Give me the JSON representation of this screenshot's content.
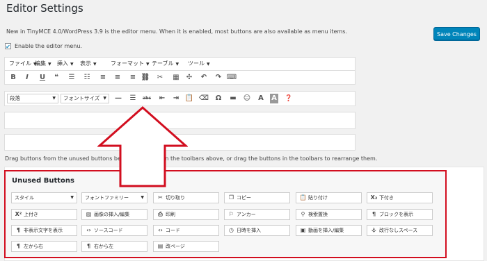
{
  "page": {
    "title": "Editor Settings",
    "description": "New in TinyMCE 4.0/WordPress 3.9 is the editor menu. When it is enabled, most buttons are also available as menu items.",
    "save_label": "Save Changes",
    "enable_label": "Enable the editor menu.",
    "enable_checked": "✔",
    "drag_text": "Drag buttons from the unused buttons be",
    "drag_text_tail": "em in the toolbars above, or drag the buttons in the toolbars to rearrange them."
  },
  "menubar": [
    "ファイル",
    "編集",
    "挿入",
    "表示",
    "フォーマット",
    "テーブル",
    "ツール"
  ],
  "toolbar1": [
    {
      "icon": "bold-icon",
      "glyph": "B"
    },
    {
      "icon": "italic-icon",
      "glyph": "I"
    },
    {
      "icon": "underline-icon",
      "glyph": "U"
    },
    {
      "icon": "blockquote-icon",
      "glyph": "❝"
    },
    {
      "icon": "bullet-list-icon",
      "glyph": "☰"
    },
    {
      "icon": "numbered-list-icon",
      "glyph": "☷"
    },
    {
      "icon": "align-left-icon",
      "glyph": "≡"
    },
    {
      "icon": "align-center-icon",
      "glyph": "≡"
    },
    {
      "icon": "align-right-icon",
      "glyph": "≡"
    },
    {
      "icon": "link-icon",
      "glyph": "⛓"
    },
    {
      "icon": "unlink-icon",
      "glyph": "✂"
    },
    {
      "icon": "table-icon",
      "glyph": "▦"
    },
    {
      "icon": "fullscreen-icon",
      "glyph": "✣"
    },
    {
      "icon": "undo-icon",
      "glyph": "↶"
    },
    {
      "icon": "redo-icon",
      "glyph": "↷"
    },
    {
      "icon": "keyboard-icon",
      "glyph": "⌨"
    }
  ],
  "toolbar2": {
    "format_select": "段落",
    "fontsize_select": "フォントサイズ",
    "buttons": [
      {
        "icon": "horizontal-rule-icon",
        "glyph": "—"
      },
      {
        "icon": "justify-icon",
        "glyph": "☰"
      },
      {
        "icon": "strikethrough-icon",
        "glyph": "abc"
      },
      {
        "icon": "outdent-icon",
        "glyph": "⇤"
      },
      {
        "icon": "indent-icon",
        "glyph": "⇥"
      },
      {
        "icon": "paste-text-icon",
        "glyph": "📋"
      },
      {
        "icon": "eraser-icon",
        "glyph": "⌫"
      },
      {
        "icon": "omega-icon",
        "glyph": "Ω"
      },
      {
        "icon": "media-icon",
        "glyph": "▬"
      },
      {
        "icon": "emoticon-icon",
        "glyph": "☺"
      },
      {
        "icon": "text-color-icon",
        "glyph": "A"
      },
      {
        "icon": "background-color-icon",
        "glyph": "A"
      },
      {
        "icon": "help-icon",
        "glyph": "❓"
      }
    ]
  },
  "unused": {
    "title": "Unused Buttons",
    "rows": [
      [
        {
          "label": "スタイル",
          "icon": "",
          "dropdown": true
        },
        {
          "label": "フォントファミリー",
          "icon": "",
          "dropdown": true
        },
        {
          "label": "切り取り",
          "icon": "✂",
          "name": "scissors-icon"
        },
        {
          "label": "コピー",
          "icon": "❐",
          "name": "copy-icon"
        },
        {
          "label": "貼り付け",
          "icon": "📋",
          "name": "paste-icon"
        },
        {
          "label": "下付き",
          "icon": "X₂",
          "name": "subscript-icon"
        }
      ],
      [
        {
          "label": "上付き",
          "icon": "X²",
          "name": "superscript-icon"
        },
        {
          "label": "画像の挿入/編集",
          "icon": "▨",
          "name": "image-icon"
        },
        {
          "label": "印刷",
          "icon": "⎙",
          "name": "print-icon"
        },
        {
          "label": "アンカー",
          "icon": "⚐",
          "name": "anchor-icon"
        },
        {
          "label": "検索置換",
          "icon": "⚲",
          "name": "search-replace-icon"
        },
        {
          "label": "ブロックを表示",
          "icon": "¶",
          "name": "pilcrow-icon"
        }
      ],
      [
        {
          "label": "非表示文字を表示",
          "icon": "¶",
          "name": "invisible-chars-icon"
        },
        {
          "label": "ソースコード",
          "icon": "‹›",
          "name": "source-code-icon"
        },
        {
          "label": "コード",
          "icon": "‹›",
          "name": "code-icon"
        },
        {
          "label": "日時を挿入",
          "icon": "◷",
          "name": "clock-icon"
        },
        {
          "label": "動画を挿入/編集",
          "icon": "▣",
          "name": "video-icon"
        },
        {
          "label": "改行なしスペース",
          "icon": "⎀",
          "name": "nbsp-icon"
        }
      ],
      [
        {
          "label": "左から右",
          "icon": "¶",
          "name": "ltr-icon"
        },
        {
          "label": "右から左",
          "icon": "¶",
          "name": "rtl-icon"
        },
        {
          "label": "改ページ",
          "icon": "▤",
          "name": "pagebreak-icon"
        }
      ]
    ]
  }
}
